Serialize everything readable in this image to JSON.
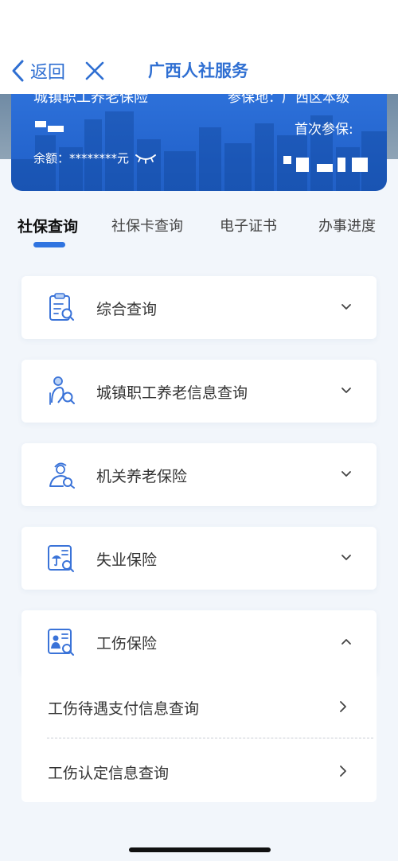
{
  "navbar": {
    "back_label": "返回",
    "title": "广西人社服务"
  },
  "hero": {
    "insurance_name": "城镇职工养老保险",
    "insured_place": "参保地：广西区本级",
    "first_insured": "首次参保:",
    "balance": "余额：********元"
  },
  "tabs": [
    {
      "label": "社保查询",
      "active": true
    },
    {
      "label": "社保卡查询",
      "active": false
    },
    {
      "label": "电子证书",
      "active": false
    },
    {
      "label": "办事进度",
      "active": false
    }
  ],
  "cards": [
    {
      "label": "综合查询",
      "icon": "clipboard-search-icon",
      "expanded": false
    },
    {
      "label": "城镇职工养老信息查询",
      "icon": "elderly-search-icon",
      "expanded": false
    },
    {
      "label": "机关养老保险",
      "icon": "official-search-icon",
      "expanded": false
    },
    {
      "label": "失业保险",
      "icon": "umbrella-doc-search-icon",
      "expanded": false
    },
    {
      "label": "工伤保险",
      "icon": "injury-doc-search-icon",
      "expanded": true
    }
  ],
  "work_injury_items": [
    {
      "label": "工伤待遇支付信息查询"
    },
    {
      "label": "工伤认定信息查询"
    }
  ],
  "colors": {
    "accent": "#2f6fd2",
    "hero": "#2566cf",
    "background": "#f2f6fb"
  }
}
